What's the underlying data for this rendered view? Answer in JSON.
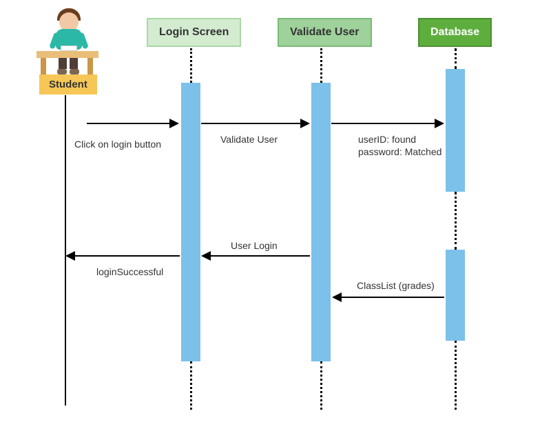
{
  "actor": {
    "label": "Student"
  },
  "participants": {
    "login_screen": {
      "title": "Login Screen"
    },
    "validate_user": {
      "title": "Validate User"
    },
    "database": {
      "title": "Database"
    }
  },
  "messages": {
    "m1": {
      "label": "Click on login button"
    },
    "m2": {
      "label": "Validate User"
    },
    "m3_line1": "userID: found",
    "m3_line2": "password: Matched",
    "m4": {
      "label": "ClassList (grades)"
    },
    "m5": {
      "label": "User Login"
    },
    "m6": {
      "label": "loginSuccessful"
    }
  }
}
